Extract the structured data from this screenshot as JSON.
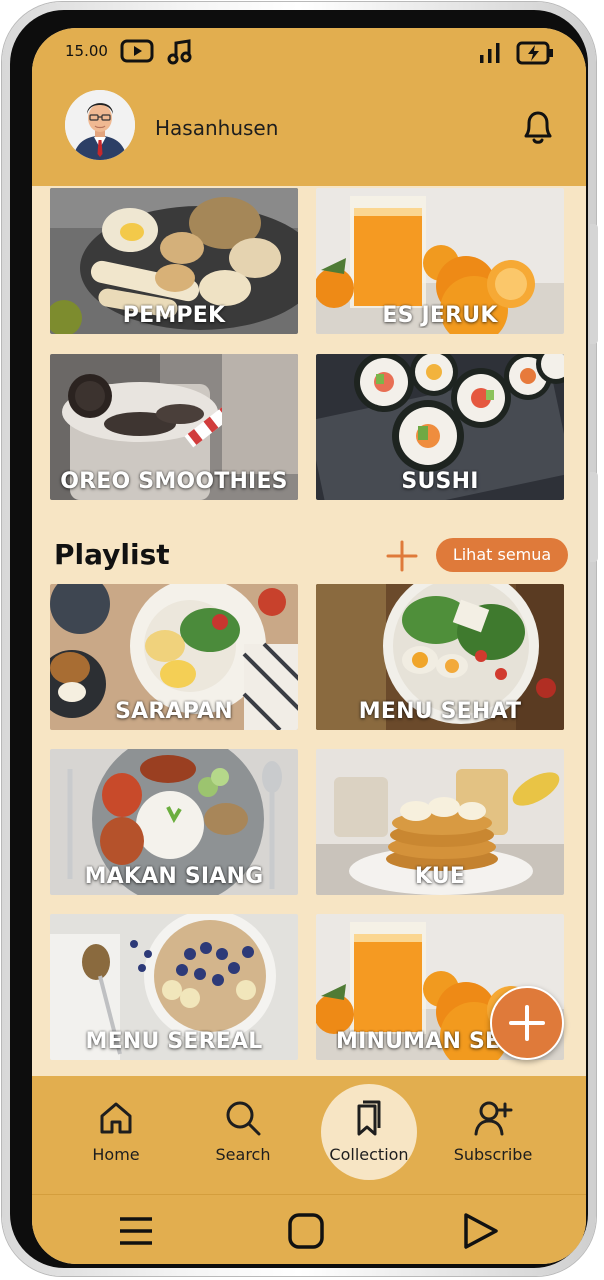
{
  "status_bar": {
    "time": "15.00",
    "icons": [
      "youtube-icon",
      "music-note-icon",
      "signal-icon",
      "battery-charging-icon"
    ]
  },
  "header": {
    "username": "Hasanhusen",
    "avatar": "avatar",
    "notification_icon": "bell-icon"
  },
  "collections": [
    {
      "label": "PEMPEK"
    },
    {
      "label": "ES JERUK"
    },
    {
      "label": "OREO SMOOTHIES"
    },
    {
      "label": "SUSHI"
    }
  ],
  "playlist": {
    "title": "Playlist",
    "add_icon": "plus-icon",
    "see_all_label": "Lihat semua",
    "items": [
      {
        "label": "SARAPAN"
      },
      {
        "label": "MENU SEHAT"
      },
      {
        "label": "MAKAN SIANG"
      },
      {
        "label": "KUE"
      },
      {
        "label": "MENU SEREAL"
      },
      {
        "label": "MINUMAN SE"
      }
    ]
  },
  "fab_icon": "plus-icon",
  "bottom_nav": [
    {
      "label": "Home",
      "icon": "home-icon"
    },
    {
      "label": "Search",
      "icon": "search-icon"
    },
    {
      "label": "Collection",
      "icon": "bookmark-icon",
      "active": true
    },
    {
      "label": "Subscribe",
      "icon": "user-plus-icon"
    }
  ],
  "system_nav": [
    "menu-icon",
    "home-square-icon",
    "back-triangle-icon"
  ],
  "colors": {
    "header_bg": "#e2ae4f",
    "content_bg": "#f7e5c4",
    "accent": "#df7a3a"
  }
}
